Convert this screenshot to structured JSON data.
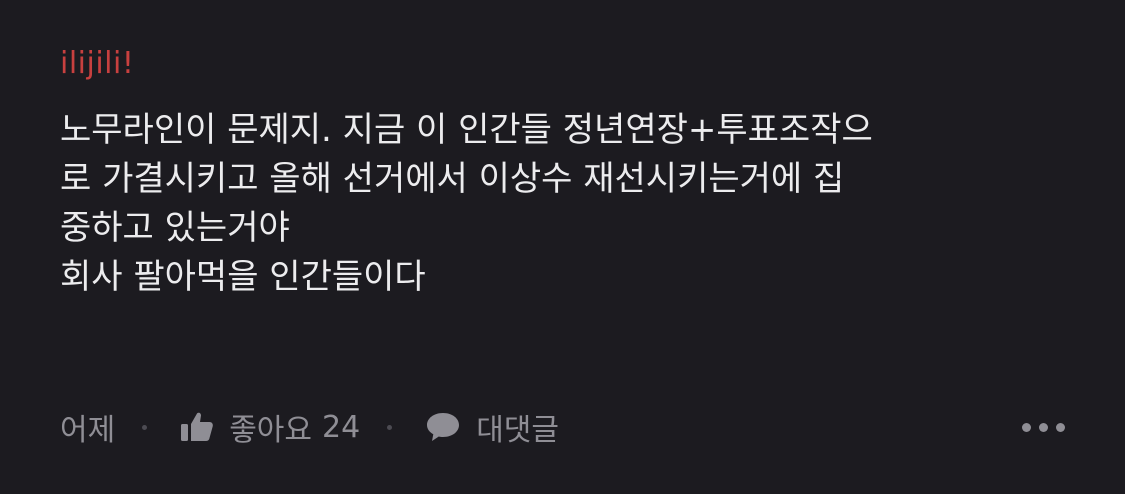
{
  "comment": {
    "author": "ilijili!",
    "lines": [
      "노무라인이 문제지. 지금 이 인간들 정년연장+투표조작으",
      "로 가결시키고 올해 선거에서 이상수 재선시키는거에 집",
      "중하고 있는거야",
      "회사 팔아먹을 인간들이다"
    ],
    "time": "어제",
    "like_label": "좋아요",
    "like_count": "24",
    "reply_label": "대댓글"
  },
  "icons": {
    "like": "thumbs-up-icon",
    "reply": "speech-bubble-icon",
    "more": "more-horizontal-icon"
  },
  "colors": {
    "background": "#1c1b20",
    "author": "#c8403f",
    "body_text": "#ececee",
    "meta_text": "#8f8e95"
  }
}
